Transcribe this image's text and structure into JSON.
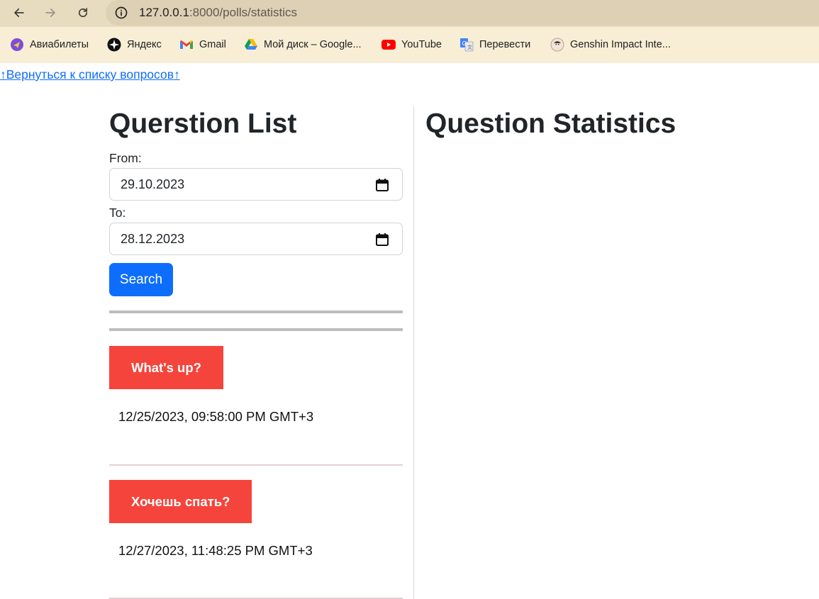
{
  "browser": {
    "url_host": "127.0.0.1",
    "url_path": ":8000/polls/statistics",
    "bookmarks": [
      {
        "label": "Авиабилеты",
        "icon": "aviabilety-icon"
      },
      {
        "label": "Яндекс",
        "icon": "yandex-icon"
      },
      {
        "label": "Gmail",
        "icon": "gmail-icon"
      },
      {
        "label": "Мой диск – Google...",
        "icon": "google-drive-icon"
      },
      {
        "label": "YouTube",
        "icon": "youtube-icon"
      },
      {
        "label": "Перевести",
        "icon": "translate-icon"
      },
      {
        "label": "Genshin Impact Inte...",
        "icon": "genshin-icon"
      }
    ]
  },
  "page": {
    "back_link": "↑Вернуться к списку вопросов↑",
    "left_title": "Querstion List",
    "right_title": "Question Statistics",
    "from_label": "From:",
    "from_value": "29.10.2023",
    "to_label": "To:",
    "to_value": "28.12.2023",
    "search_label": "Search",
    "questions": [
      {
        "label": "What's up?",
        "date": "12/25/2023, 09:58:00 PM GMT+3"
      },
      {
        "label": "Хочешь спать?",
        "date": "12/27/2023, 11:48:25 PM GMT+3"
      }
    ]
  },
  "colors": {
    "accent": "#0d6efd",
    "question_button": "#f5443b",
    "toolbar": "#e8dcc0",
    "bookmarks_bar": "#f8eed6"
  }
}
